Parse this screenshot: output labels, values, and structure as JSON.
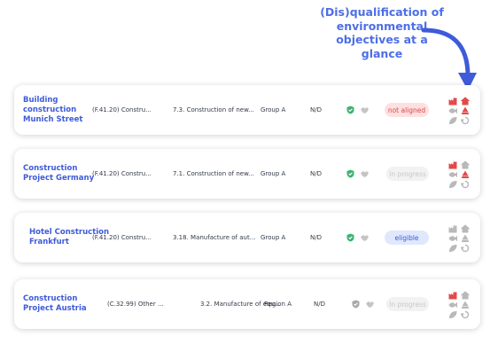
{
  "callout": {
    "line1": "(Dis)qualification of",
    "line2": "environmental",
    "line3": "objectives at a glance"
  },
  "colors": {
    "brand_blue": "#3e5bd9",
    "not_aligned": "#e04848",
    "eligible_bg": "#dfe8fc",
    "green_check": "#3cb371",
    "icon_grey": "#b9b9b9"
  },
  "rows": [
    {
      "name_line1": "Building construction",
      "name_line2": "Munich Street",
      "nace": "(F.41.20) Constru...",
      "activity": "7.3. Construction of new...",
      "group": "Group A",
      "value": "N/D",
      "status": "not aligned",
      "status_type": "not-aligned",
      "check_color": "green",
      "objectives": [
        "factory-icon-red",
        "house-icon-red",
        "fish-icon-grey",
        "recycle-icon-red",
        "leaf-icon-grey",
        "cycle-icon-grey"
      ]
    },
    {
      "name_line1": "Construction",
      "name_line2": "Project Germany",
      "nace": "(F.41.20) Constru...",
      "activity": "7.1. Construction of new...",
      "group": "Group A",
      "value": "N/D",
      "status": "In progress",
      "status_type": "in-progress",
      "check_color": "green",
      "objectives": [
        "factory-icon-red",
        "house-icon-grey",
        "fish-icon-grey",
        "recycle-icon-red",
        "leaf-icon-grey",
        "cycle-icon-grey"
      ]
    },
    {
      "name_line1": "Hotel Construction",
      "name_line2": "Frankfurt",
      "nace": "(F.41.20) Constru...",
      "activity": "3.18. Manufacture of aut...",
      "group": "Group A",
      "value": "N/D",
      "status": "eligible",
      "status_type": "eligible",
      "check_color": "green",
      "objectives": [
        "factory-icon-grey",
        "house-icon-grey",
        "fish-icon-grey",
        "recycle-icon-grey",
        "leaf-icon-grey",
        "cycle-icon-grey"
      ]
    },
    {
      "name_line1": "Construction",
      "name_line2": "Project Austria",
      "nace": "(C.32.99) Other ...",
      "activity": "3.2. Manufacture of equ...",
      "group": "Region A",
      "value": "N/D",
      "status": "In progress",
      "status_type": "in-progress",
      "check_color": "grey",
      "objectives": [
        "factory-icon-red",
        "house-icon-grey",
        "fish-icon-grey",
        "recycle-icon-grey",
        "leaf-icon-grey",
        "cycle-icon-grey"
      ]
    }
  ]
}
